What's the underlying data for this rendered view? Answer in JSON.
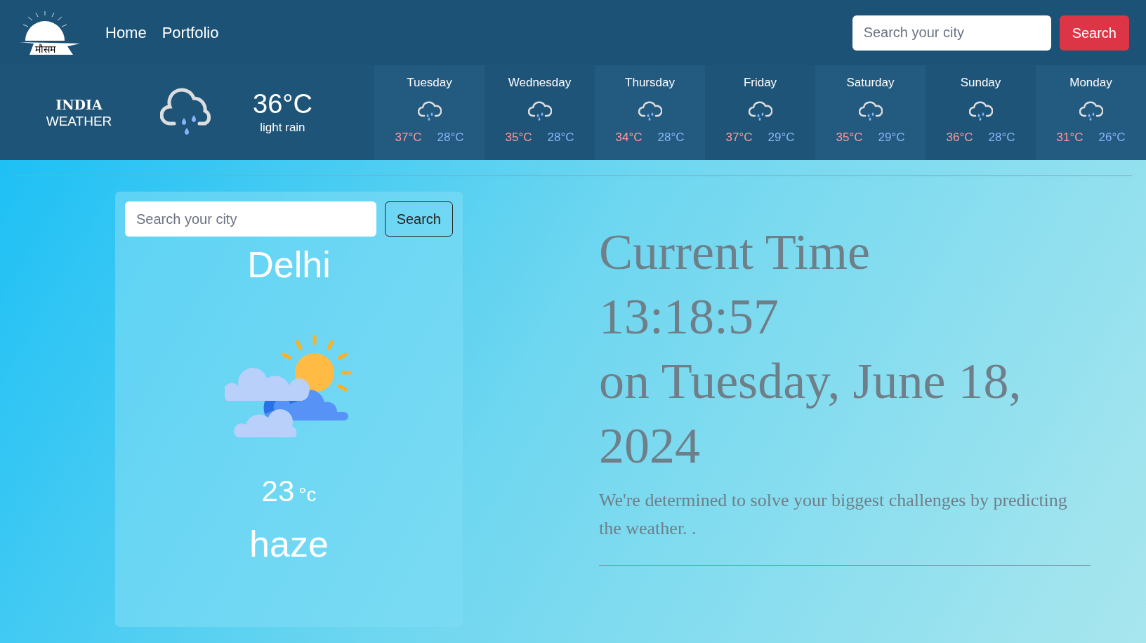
{
  "logo": {
    "text": "मौसम"
  },
  "nav": [
    {
      "label": "Home"
    },
    {
      "label": "Portfolio"
    }
  ],
  "header_search": {
    "placeholder": "Search your city",
    "button": "Search"
  },
  "current": {
    "title_line_1": "INDIA",
    "title_line_2": "WEATHER",
    "temperature": "36°C",
    "description": "light rain"
  },
  "forecast": [
    {
      "day": "Tuesday",
      "high": "37°C",
      "low": "28°C"
    },
    {
      "day": "Wednesday",
      "high": "35°C",
      "low": "28°C"
    },
    {
      "day": "Thursday",
      "high": "34°C",
      "low": "28°C"
    },
    {
      "day": "Friday",
      "high": "37°C",
      "low": "29°C"
    },
    {
      "day": "Saturday",
      "high": "35°C",
      "low": "29°C"
    },
    {
      "day": "Sunday",
      "high": "36°C",
      "low": "28°C"
    },
    {
      "day": "Monday",
      "high": "31°C",
      "low": "26°C"
    }
  ],
  "card": {
    "placeholder": "Search your city",
    "button": "Search",
    "city": "Delhi",
    "temperature": "23",
    "unit": "°c",
    "condition": "haze"
  },
  "time_panel": {
    "lines": [
      "Current Time",
      "13:18:57",
      "on Tuesday, June 18, 2024"
    ],
    "tagline": "We're determined to solve your biggest challenges by predicting the weather. ."
  }
}
